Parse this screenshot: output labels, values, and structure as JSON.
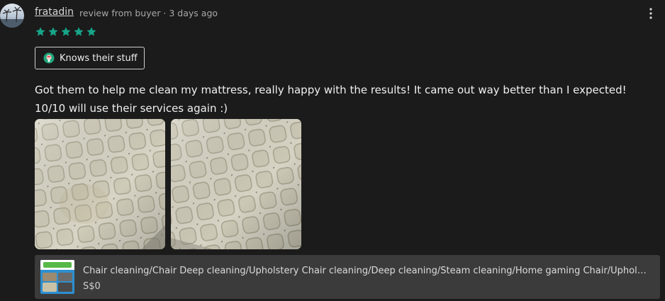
{
  "review": {
    "username": "fratadin",
    "meta": "review from buyer · 3 days ago",
    "rating": 5,
    "badge_label": "Knows their stuff",
    "text": "Got them to help me clean my mattress, really happy with the results! It came out way better than I expected! 10/10 will use their services again :)"
  },
  "product": {
    "title": "Chair cleaning/Chair Deep cleaning/Upholstery Chair cleaning/Deep cleaning/Steam cleaning/Home gaming Chair/Upholstery...",
    "price": "S$0"
  },
  "icons": {
    "avatar": "avatar-image",
    "more": "vertical-ellipsis-icon",
    "star": "star-icon",
    "badge": "expert-badge-icon"
  },
  "colors": {
    "background": "#1b1b1b",
    "star": "#17a589",
    "product_card": "#3b3b3b"
  }
}
